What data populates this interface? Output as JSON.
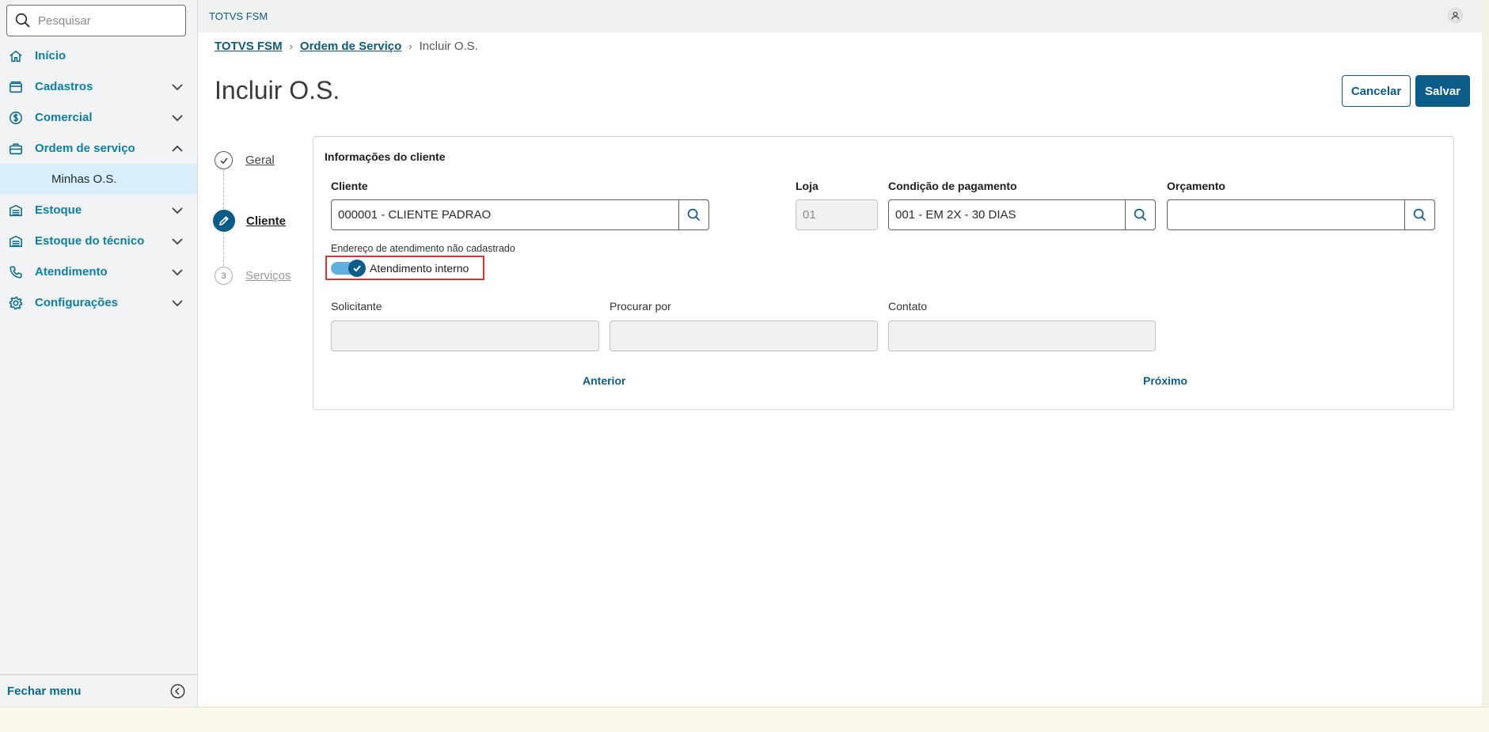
{
  "search": {
    "placeholder": "Pesquisar"
  },
  "sidebar": {
    "items": [
      {
        "label": "Início",
        "icon": "home-icon"
      },
      {
        "label": "Cadastros",
        "icon": "folder-icon"
      },
      {
        "label": "Comercial",
        "icon": "dollar-icon"
      },
      {
        "label": "Ordem de serviço",
        "icon": "briefcase-icon"
      },
      {
        "label": "Minhas O.S."
      },
      {
        "label": "Estoque",
        "icon": "warehouse-icon"
      },
      {
        "label": "Estoque do técnico",
        "icon": "warehouse-icon"
      },
      {
        "label": "Atendimento",
        "icon": "phone-icon"
      },
      {
        "label": "Configurações",
        "icon": "gear-icon"
      }
    ],
    "footer_label": "Fechar menu"
  },
  "topbar": {
    "app_name": "TOTVS FSM"
  },
  "breadcrumb": {
    "items": [
      "TOTVS FSM",
      "Ordem de Serviço",
      "Incluir O.S."
    ]
  },
  "page": {
    "title": "Incluir O.S."
  },
  "actions": {
    "cancel": "Cancelar",
    "save": "Salvar"
  },
  "stepper": {
    "steps": [
      {
        "label": "Geral",
        "state": "done"
      },
      {
        "label": "Cliente",
        "state": "active"
      },
      {
        "label": "Serviços",
        "state": "todo",
        "number": "3"
      }
    ]
  },
  "form": {
    "section_title": "Informações do cliente",
    "cliente": {
      "label": "Cliente",
      "value": "000001 - CLIENTE PADRAO"
    },
    "loja": {
      "label": "Loja",
      "value": "01"
    },
    "condicao": {
      "label": "Condição de pagamento",
      "value": "001 - EM 2X - 30 DIAS"
    },
    "orcamento": {
      "label": "Orçamento",
      "value": ""
    },
    "hint": "Endereço de atendimento não cadastrado",
    "toggle": {
      "label": "Atendimento interno",
      "checked": true
    },
    "solicitante": {
      "label": "Solicitante",
      "value": ""
    },
    "procurar_por": {
      "label": "Procurar por",
      "value": ""
    },
    "contato": {
      "label": "Contato",
      "value": ""
    },
    "prev": "Anterior",
    "next": "Próximo"
  },
  "colors": {
    "primary": "#0c5c8a",
    "link": "#0c7fa3",
    "highlight": "#e03030"
  }
}
